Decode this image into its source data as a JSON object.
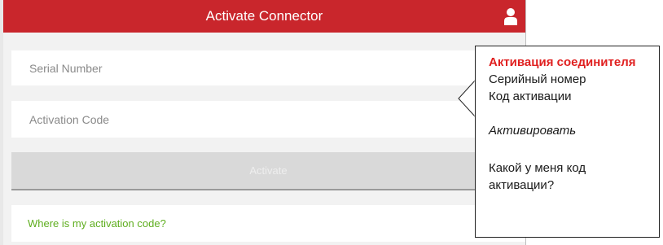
{
  "header": {
    "title": "Activate Connector"
  },
  "form": {
    "serial_placeholder": "Serial Number",
    "code_placeholder": "Activation Code",
    "activate_label": "Activate",
    "help_link": "Where is my activation code?"
  },
  "callout": {
    "title": "Активация соединителя",
    "line_serial": "Серийный номер",
    "line_code": "Код активации",
    "line_activate": "Активировать",
    "line_question": "Какой у меня код активации?"
  },
  "colors": {
    "header_bg": "#c9262c",
    "link_green": "#5fae1f",
    "callout_title": "#e02020"
  },
  "icons": {
    "header_right": "user-icon"
  }
}
